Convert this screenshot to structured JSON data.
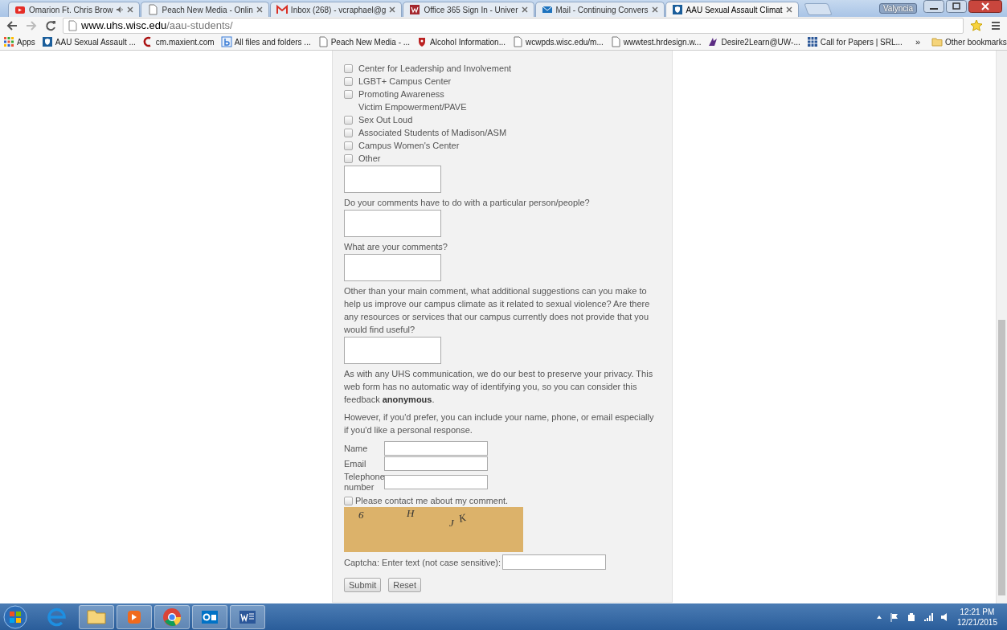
{
  "browser": {
    "tabs": [
      {
        "title": "Omarion Ft. Chris Brow",
        "kind": "video",
        "audio": true,
        "selected": false
      },
      {
        "title": "Peach New Media - Onlin",
        "kind": "page",
        "audio": false,
        "selected": false
      },
      {
        "title": "Inbox (268) - vcraphael@g",
        "kind": "mail-m",
        "audio": false,
        "selected": false
      },
      {
        "title": "Office 365 Sign In - Univer",
        "kind": "office",
        "audio": false,
        "selected": false
      },
      {
        "title": "Mail - Continuing Convers",
        "kind": "envelope",
        "audio": false,
        "selected": false
      },
      {
        "title": "AAU Sexual Assault Climat",
        "kind": "shield",
        "audio": false,
        "selected": true
      }
    ],
    "profile": "Valyncia",
    "url": {
      "host": "www.uhs.wisc.edu",
      "path": "/aau-students/"
    },
    "bookmarks": [
      {
        "label": "Apps",
        "kind": "grid"
      },
      {
        "label": "AAU Sexual Assault ...",
        "kind": "shield"
      },
      {
        "label": "cm.maxient.com",
        "kind": "crescent"
      },
      {
        "label": "All files and folders ...",
        "kind": "b"
      },
      {
        "label": "Peach New Media - ...",
        "kind": "page"
      },
      {
        "label": "Alcohol Information...",
        "kind": "crest"
      },
      {
        "label": "wcwpds.wisc.edu/m...",
        "kind": "page"
      },
      {
        "label": "wwwtest.hrdesign.w...",
        "kind": "page"
      },
      {
        "label": "Desire2Learn@UW-...",
        "kind": "d2l"
      },
      {
        "label": "Call for Papers | SRL...",
        "kind": "table"
      }
    ],
    "more": "»",
    "other_bookmarks": "Other bookmarks"
  },
  "form": {
    "checkboxes": [
      {
        "lines": [
          "Center for Leadership and Involvement"
        ],
        "checked": false
      },
      {
        "lines": [
          "LGBT+ Campus Center"
        ],
        "checked": false
      },
      {
        "lines": [
          "Promoting Awareness",
          "Victim Empowerment/PAVE"
        ],
        "checked": false
      },
      {
        "lines": [
          "Sex Out Loud"
        ],
        "checked": false
      },
      {
        "lines": [
          "Associated Students of Madison/ASM"
        ],
        "checked": false
      },
      {
        "lines": [
          "Campus Women's Center"
        ],
        "checked": false
      },
      {
        "lines": [
          "Other"
        ],
        "checked": false
      }
    ],
    "questions": [
      {
        "text": "Do your comments have to do with a particular person/people?"
      },
      {
        "text": "What are your comments?"
      },
      {
        "text": "Other than your main comment, what additional suggestions can you make to help us improve our campus climate as it related to sexual violence? Are there any resources or services that our campus currently does not provide that you would find useful?"
      }
    ],
    "privacy_note": "As with any UHS communication, we do our best to preserve your privacy. This web form has no automatic way of identifying you, so you can consider this feedback **anonymous**.",
    "contact_note": "However, if you'd prefer, you can include your name, phone, or email especially if you'd like a personal response.",
    "fields": [
      {
        "label": "Name"
      },
      {
        "label": "Email"
      },
      {
        "label": "Telephone number"
      }
    ],
    "contact_checkbox": {
      "label": "Please contact me about my comment.",
      "checked": false
    },
    "captcha": {
      "chars": [
        "6",
        "H",
        "J",
        "K"
      ],
      "label": "Captcha: Enter text (not case sensitive):"
    },
    "buttons": [
      "Submit",
      "Reset"
    ]
  },
  "taskbar": {
    "clock": {
      "time": "12:21 PM",
      "date": "12/21/2015"
    }
  }
}
